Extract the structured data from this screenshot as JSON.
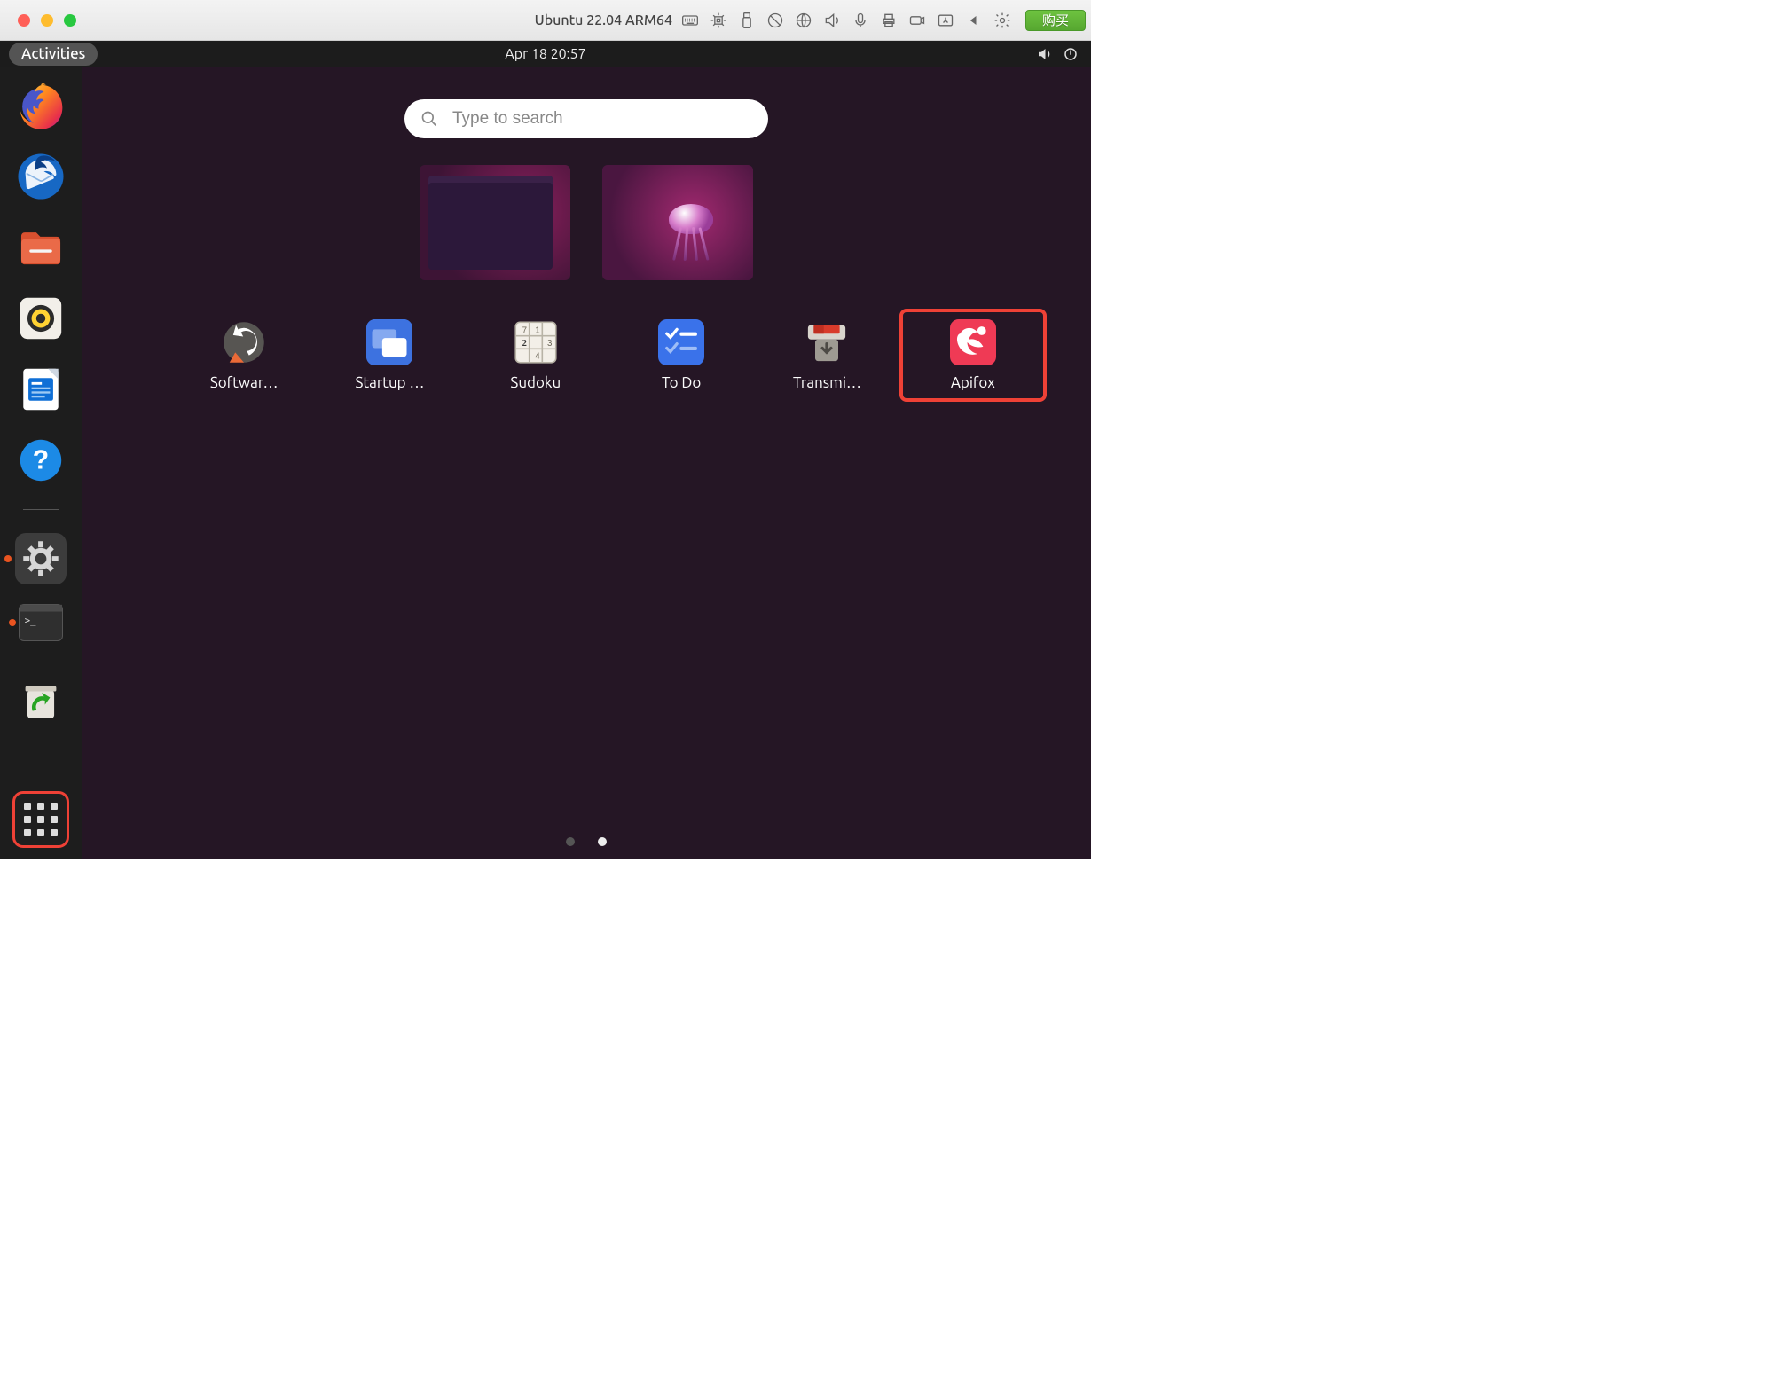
{
  "mac": {
    "title": "Ubuntu 22.04 ARM64",
    "buy_label": "购买"
  },
  "gnome": {
    "activities_label": "Activities",
    "datetime": "Apr 18  20:57"
  },
  "search": {
    "placeholder": "Type to search"
  },
  "workspaces": [
    {
      "name": "terminal-window"
    },
    {
      "name": "desktop-wallpaper"
    }
  ],
  "dock_items": [
    {
      "name": "firefox",
      "running": false
    },
    {
      "name": "thunderbird",
      "running": false
    },
    {
      "name": "files",
      "running": false
    },
    {
      "name": "rhythmbox",
      "running": false
    },
    {
      "name": "libreoffice-writer",
      "running": false
    },
    {
      "name": "help",
      "running": false
    },
    {
      "name": "settings",
      "running": true
    },
    {
      "name": "terminal",
      "running": true
    },
    {
      "name": "trash",
      "running": false
    }
  ],
  "apps": [
    {
      "label": "Softwar…",
      "icon": "software-updater"
    },
    {
      "label": "Startup …",
      "icon": "startup-apps"
    },
    {
      "label": "Sudoku",
      "icon": "sudoku"
    },
    {
      "label": "To Do",
      "icon": "todo"
    },
    {
      "label": "Transmi…",
      "icon": "transmission"
    },
    {
      "label": "Apifox",
      "icon": "apifox",
      "highlight": true
    }
  ],
  "pages": {
    "total": 2,
    "active_index": 1
  }
}
